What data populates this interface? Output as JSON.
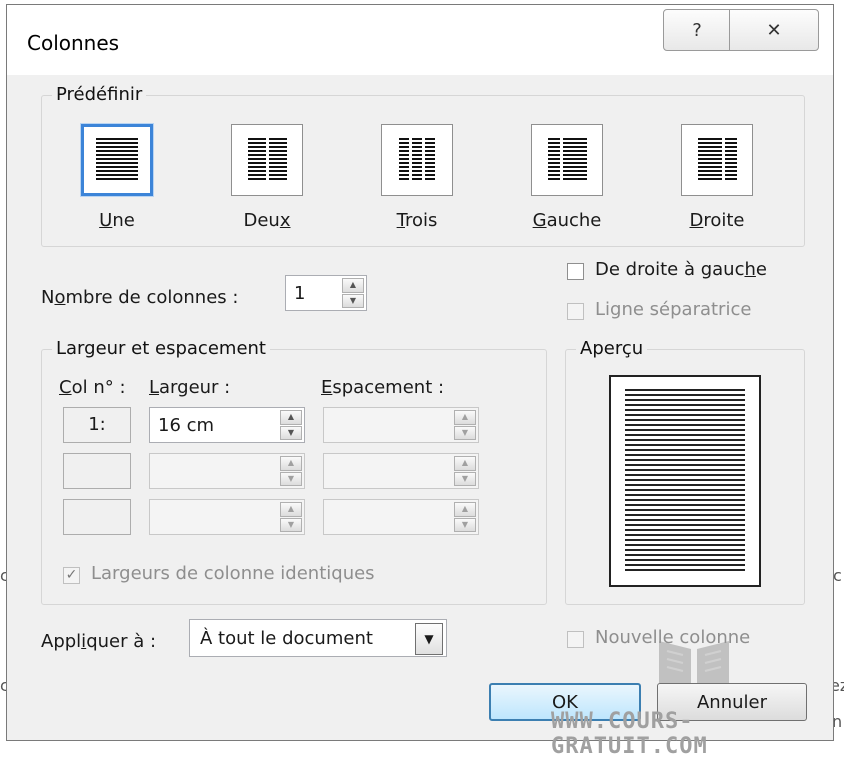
{
  "background": {
    "fragments": [
      "c",
      "c",
      "c",
      "ez",
      "n"
    ]
  },
  "dialog": {
    "title": "Colonnes",
    "help_glyph": "?",
    "close_glyph": "✕"
  },
  "presets": {
    "legend": "Prédéfinir",
    "items": [
      {
        "pre": "",
        "u": "U",
        "post": "ne",
        "selected": true,
        "icon": "one-column-icon"
      },
      {
        "pre": "Deu",
        "u": "x",
        "post": "",
        "selected": false,
        "icon": "two-columns-icon"
      },
      {
        "pre": "",
        "u": "T",
        "post": "rois",
        "selected": false,
        "icon": "three-columns-icon"
      },
      {
        "pre": "",
        "u": "G",
        "post": "auche",
        "selected": false,
        "icon": "left-column-icon"
      },
      {
        "pre": "",
        "u": "D",
        "post": "roite",
        "selected": false,
        "icon": "right-column-icon"
      }
    ]
  },
  "columns_count": {
    "label_pre": "N",
    "label_u": "o",
    "label_post": "mbre de colonnes :",
    "value": "1"
  },
  "rtl": {
    "label_pre": "De droite à gauc",
    "label_u": "h",
    "label_post": "e",
    "checked": false
  },
  "separator": {
    "label": "Ligne séparatrice",
    "checked": false,
    "disabled": true
  },
  "width_spacing": {
    "legend": "Largeur et espacement",
    "col_header_u": "C",
    "col_header_post": "ol n° :",
    "width_header_u": "L",
    "width_header_post": "argeur :",
    "spacing_header_u": "E",
    "spacing_header_post": "spacement :",
    "rows": [
      {
        "col": "1:",
        "width": "16 cm",
        "spacing": ""
      },
      {
        "col": "",
        "width": "",
        "spacing": ""
      },
      {
        "col": "",
        "width": "",
        "spacing": ""
      }
    ],
    "equal_label": "Largeurs de colonne identiques",
    "equal_checked": true
  },
  "preview": {
    "legend": "Aperçu"
  },
  "apply": {
    "label_pre": "Appl",
    "label_u": "i",
    "label_post": "quer à :",
    "value": "À tout le document"
  },
  "new_column": {
    "label": "Nouvelle colonne",
    "checked": false,
    "disabled": true
  },
  "buttons": {
    "ok": "OK",
    "cancel": "Annuler"
  },
  "watermark": "WWW.COURS-GRATUIT.COM"
}
